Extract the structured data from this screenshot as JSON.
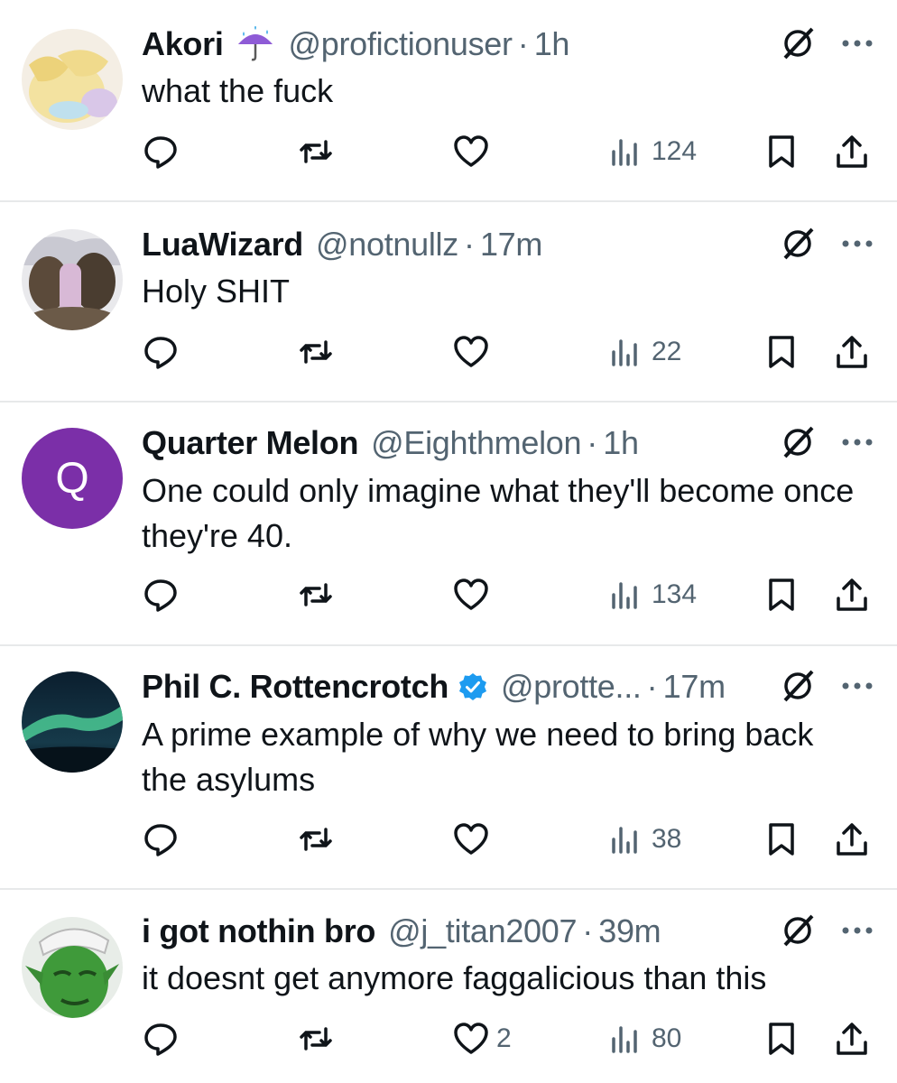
{
  "tweets": [
    {
      "name": "Akori",
      "name_emoji": "☔",
      "verified": false,
      "handle": "@profictionuser",
      "separator": "·",
      "time": "1h",
      "text": "what the fuck",
      "likes": "",
      "views": "124"
    },
    {
      "name": "LuaWizard",
      "verified": false,
      "handle": "@notnullz",
      "separator": "·",
      "time": "17m",
      "text": "Holy SHIT",
      "likes": "",
      "views": "22"
    },
    {
      "name": "Quarter Melon",
      "verified": false,
      "avatar_letter": "Q",
      "handle": "@Eighthmelon",
      "separator": "·",
      "time": "1h",
      "text": "One could only imagine what they'll become once they're 40.",
      "likes": "",
      "views": "134"
    },
    {
      "name": "Phil C. Rottencrotch",
      "verified": true,
      "handle": "@protte...",
      "separator": "·",
      "time": "17m",
      "text": "A prime example of why we need to bring back the asylums",
      "likes": "",
      "views": "38"
    },
    {
      "name": "i got nothin bro",
      "verified": false,
      "handle": "@j_titan2007",
      "separator": "·",
      "time": "39m",
      "text": "it doesnt get anymore faggalicious than this",
      "likes": "2",
      "views": "80"
    }
  ],
  "colors": {
    "text": "#0f1419",
    "muted": "#536471",
    "divider": "#e7e9ea",
    "verified": "#1d9bf0",
    "avatar_q": "#7b2fa8"
  },
  "icons": {
    "reply": "reply-icon",
    "retweet": "retweet-icon",
    "like": "heart-icon",
    "views": "views-icon",
    "bookmark": "bookmark-icon",
    "share": "share-icon",
    "grok": "grok-icon",
    "more": "more-icon"
  }
}
